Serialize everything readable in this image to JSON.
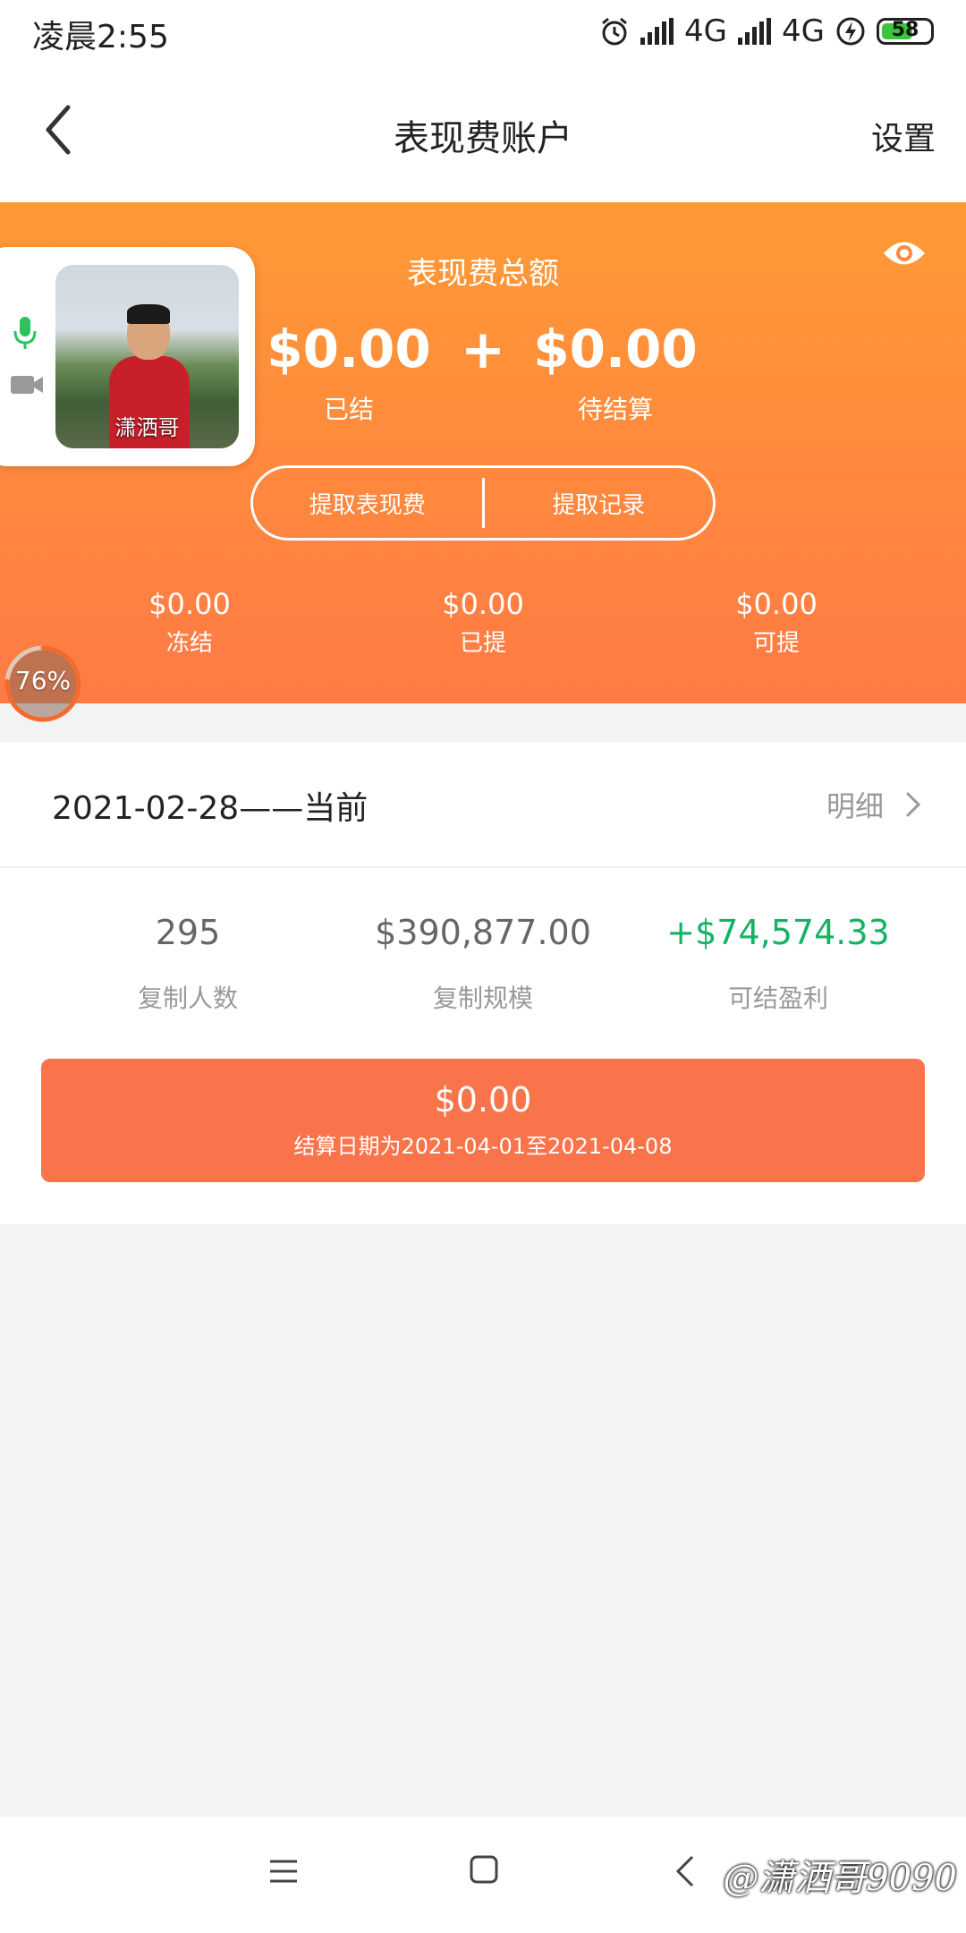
{
  "status_bar": {
    "time": "凌晨2:55",
    "network1": "4G",
    "network2": "4G",
    "battery": "58"
  },
  "header": {
    "title": "表现费账户",
    "settings": "设置"
  },
  "summary": {
    "total_label": "表现费总额",
    "settled_amount": "$0.00",
    "settled_label": "已结",
    "plus": "+",
    "pending_amount": "$0.00",
    "pending_label": "待结算",
    "withdraw_button": "提取表现费",
    "records_button": "提取记录",
    "stats": [
      {
        "value": "$0.00",
        "label": "冻结"
      },
      {
        "value": "$0.00",
        "label": "已提"
      },
      {
        "value": "$0.00",
        "label": "可提"
      }
    ]
  },
  "video_call": {
    "caller_name": "潇洒哥"
  },
  "progress_badge": {
    "text": "76%",
    "value": 0.76
  },
  "period": {
    "text": "2021-02-28——当前",
    "detail_link": "明细"
  },
  "stats": {
    "copiers_value": "295",
    "copiers_label": "复制人数",
    "scale_value": "$390,877.00",
    "scale_label": "复制规模",
    "profit_value": "+$74,574.33",
    "profit_label": "可结盈利"
  },
  "settle": {
    "amount": "$0.00",
    "date_text": "结算日期为2021-04-01至2021-04-08"
  },
  "watermark": "@潇洒哥9090",
  "colors": {
    "orange_top": "#ff9a35",
    "orange_bottom": "#ff7a45",
    "settle_button": "#f9744b",
    "profit_green": "#13b265"
  }
}
